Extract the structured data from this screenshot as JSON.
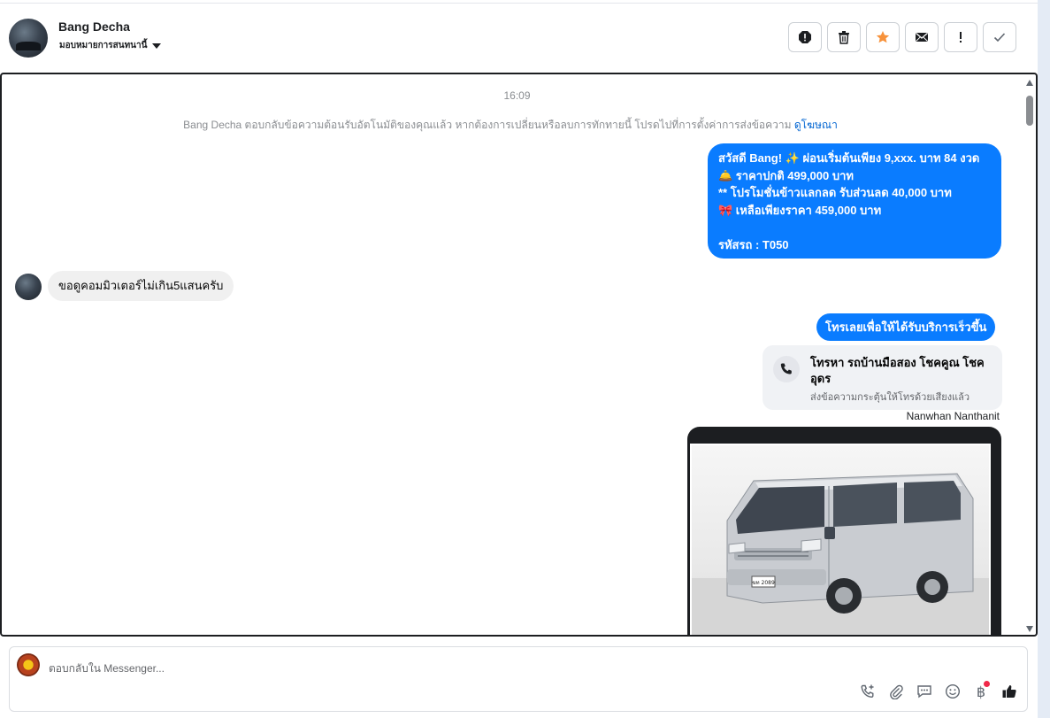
{
  "header": {
    "contact_name": "Bang Decha",
    "assign_label": "มอบหมายการสนทนานี้",
    "toolbar_icons": [
      "spam-alert-icon",
      "trash-icon",
      "star-icon",
      "envelope-icon",
      "exclamation-icon",
      "check-icon"
    ]
  },
  "conversation": {
    "timestamp": "16:09",
    "system_note": "Bang Decha ตอบกลับข้อความต้อนรับอัตโนมัติของคุณแล้ว หากต้องการเปลี่ยนหรือลบการทักทายนี้ โปรดไปที่การตั้งค่าการส่งข้อความ",
    "system_note_link": "ดูโฆษณา",
    "promo_lines": [
      "สวัสดี Bang! ✨  ผ่อนเริ่มต้นเพียง 9,xxx. บาท 84 งวด",
      "🛎️ ราคาปกติ 499,000 บาท",
      "** โปรโมชั่นข้าวแลกลด รับส่วนลด 40,000 บาท",
      "🎀  เหลือเพียงราคา 459,000 บาท",
      "รหัสรถ : T050"
    ],
    "incoming_message": "ขอดูคอมมิวเตอร์ไม่เกิน5แสนครับ",
    "call_cta": "โทรเลยเพื่อให้ได้รับบริการเร็วขึ้น",
    "call_card": {
      "title": "โทรหา รถบ้านมือสอง โชคคูณ โชคอุดร",
      "subtitle": "ส่งข้อความกระตุ้นให้โทรด้วยเสียงแล้ว"
    },
    "sender_name": "Nanwhan Nanthanit",
    "plate_text": "ฆท 2089"
  },
  "composer": {
    "placeholder": "ตอบกลับใน Messenger...",
    "icons": [
      "call-add-icon",
      "paperclip-icon",
      "saved-reply-icon",
      "emoji-icon",
      "baht-icon",
      "like-icon"
    ]
  },
  "colors": {
    "accent": "#0a7cff",
    "star": "#f7923b",
    "link": "#0064d1"
  }
}
